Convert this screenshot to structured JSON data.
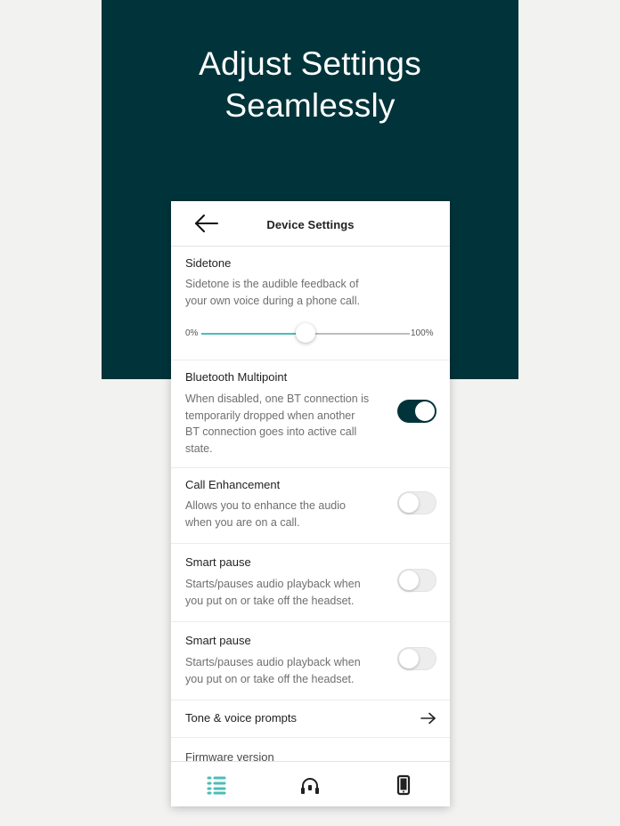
{
  "hero": {
    "title_line1": "Adjust Settings",
    "title_line2": "Seamlessly"
  },
  "header": {
    "title": "Device Settings",
    "back_icon": "arrow-left-icon"
  },
  "sidetone": {
    "title": "Sidetone",
    "description_line1": "Sidetone is the audible feedback of",
    "description_line2": "your own voice during a phone call.",
    "min_label": "0%",
    "max_label": "100%",
    "value_percent": 50
  },
  "bluetooth_multipoint": {
    "title": "Bluetooth Multipoint",
    "description_lines": [
      "When disabled, one BT connection is",
      "temporarily dropped when another",
      "BT connection goes into active call",
      "state."
    ],
    "enabled": true
  },
  "call_enhancement": {
    "title": "Call Enhancement",
    "description_lines": [
      "Allows you to enhance the audio",
      "when you are on a call."
    ],
    "enabled": false
  },
  "smart_pause_1": {
    "title": "Smart pause",
    "description_lines": [
      "Starts/pauses audio playback when",
      "you put on or take off the headset."
    ],
    "enabled": false
  },
  "smart_pause_2": {
    "title": "Smart pause",
    "description_lines": [
      "Starts/pauses audio playback when",
      "you put on or take off the headset."
    ],
    "enabled": false
  },
  "tone_prompts": {
    "label": "Tone & voice prompts",
    "icon": "arrow-right-icon"
  },
  "firmware": {
    "label": "Firmware version"
  },
  "bottom_nav": {
    "items": [
      {
        "icon": "settings-list-icon",
        "active": true
      },
      {
        "icon": "headset-icon",
        "active": false
      },
      {
        "icon": "phone-icon",
        "active": false
      }
    ]
  },
  "colors": {
    "brand_dark": "#01343a",
    "accent_teal": "#4cbdb4"
  }
}
